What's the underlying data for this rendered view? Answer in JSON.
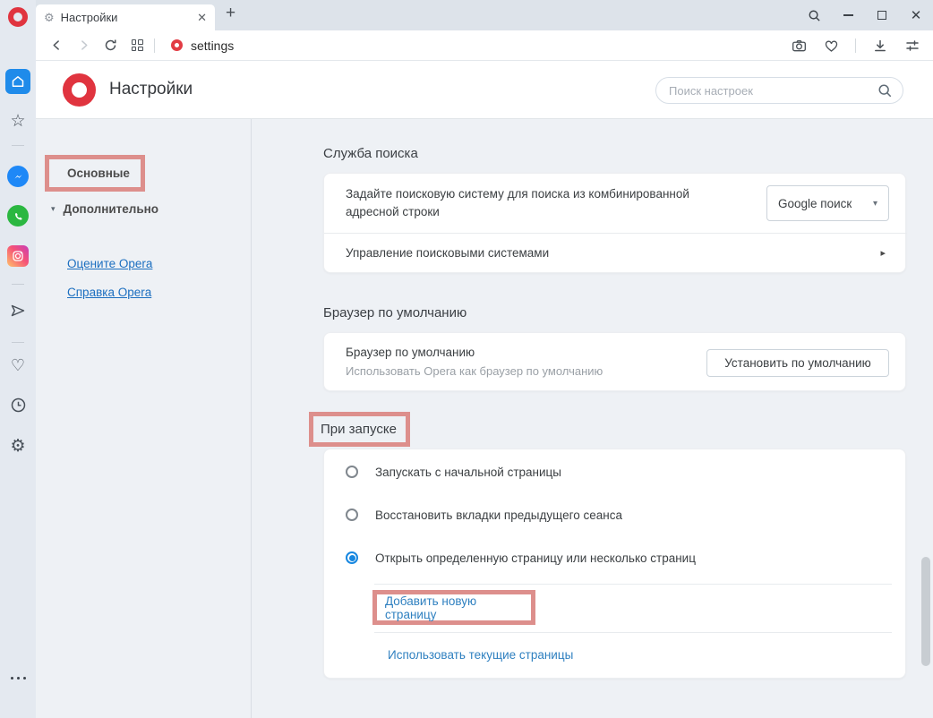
{
  "browser": {
    "tab_title": "Настройки",
    "url": "settings"
  },
  "icons": {
    "gear": "⚙",
    "star": "☆",
    "heart": "♡",
    "close": "✕",
    "plus": "+",
    "caret_down": "▾",
    "chevron_right": "▸",
    "nav_triangle": "▾"
  },
  "header": {
    "title": "Настройки",
    "search_placeholder": "Поиск настроек"
  },
  "nav": {
    "basic": "Основные",
    "advanced": "Дополнительно",
    "rate_link": "Оцените Opera",
    "help_link": "Справка Opera"
  },
  "sections": {
    "search_service": {
      "heading": "Служба поиска",
      "set_engine_text": "Задайте поисковую систему для поиска из комбинированной адресной строки",
      "engine_value": "Google поиск",
      "manage_text": "Управление поисковыми системами"
    },
    "default_browser": {
      "heading": "Браузер по умолчанию",
      "row_title": "Браузер по умолчанию",
      "row_subtitle": "Использовать Opera как браузер по умолчанию",
      "set_default_button": "Установить по умолчанию"
    },
    "startup": {
      "heading": "При запуске",
      "options": [
        {
          "label": "Запускать с начальной страницы",
          "selected": false
        },
        {
          "label": "Восстановить вкладки предыдущего сеанса",
          "selected": false
        },
        {
          "label": "Открыть определенную страницу или несколько страниц",
          "selected": true
        }
      ],
      "add_page_link": "Добавить новую страницу",
      "use_current_link": "Использовать текущие страницы"
    }
  },
  "colors": {
    "brand_red": "#e0343f",
    "accent_blue": "#1787e0",
    "sidebar_active_blue": "#1f8bea",
    "link_blue": "#1c6fc0",
    "annotation_pink": "#dd8f8c"
  }
}
